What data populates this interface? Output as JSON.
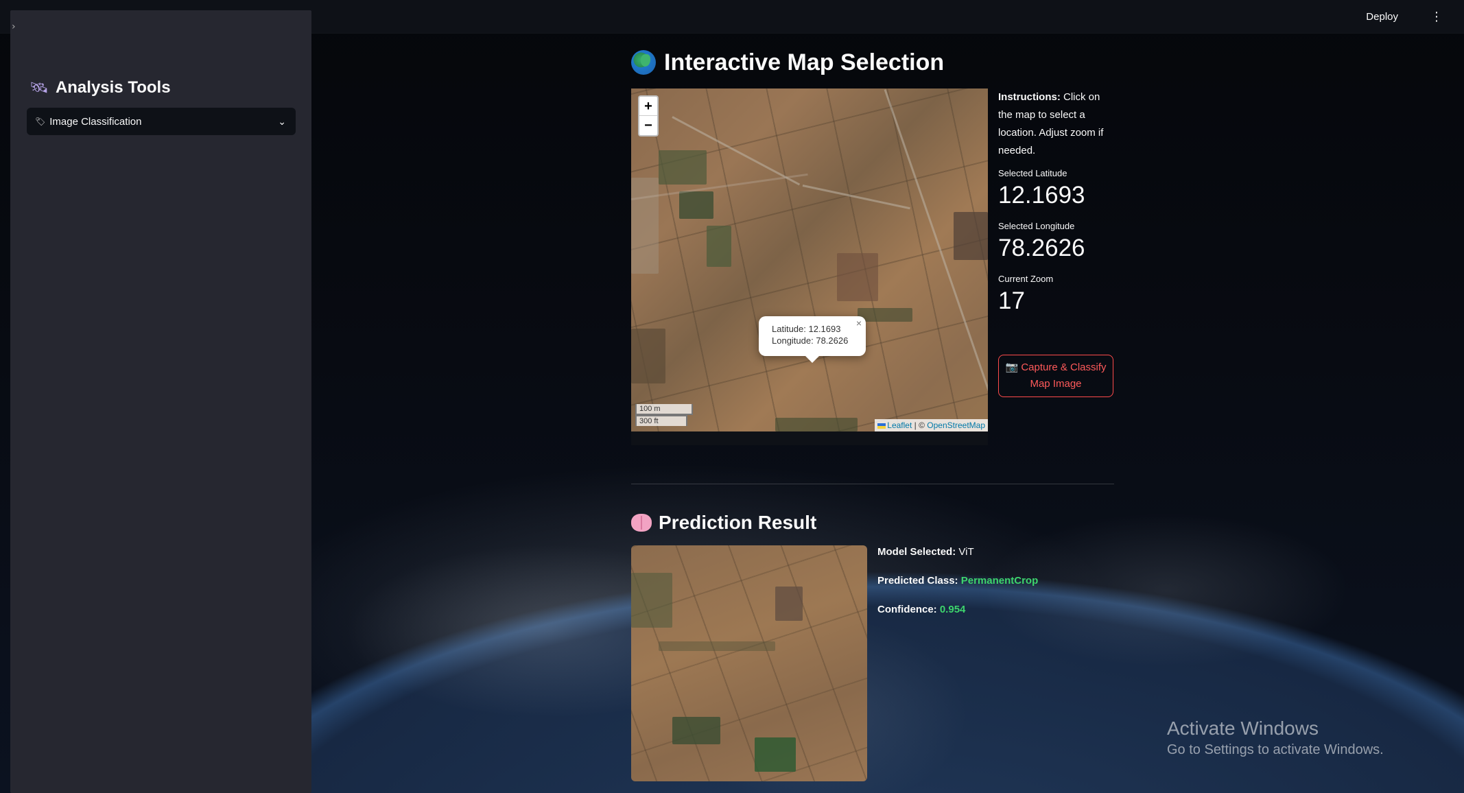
{
  "header": {
    "deploy_label": "Deploy",
    "menu_glyph": "⋮"
  },
  "sidebar": {
    "collapse_glyph": "›",
    "title_icon": "satellite-icon",
    "title": "Analysis Tools",
    "select": {
      "icon": "label-tag-icon",
      "value": "Image Classification"
    }
  },
  "map_section": {
    "title": "Interactive Map Selection",
    "icon": "globe-icon",
    "zoom_in": "+",
    "zoom_out": "−",
    "popup": {
      "latitude_line": "Latitude: 12.1693",
      "longitude_line": "Longitude: 78.2626",
      "close": "×"
    },
    "scale": {
      "metric": "100 m",
      "imperial": "300 ft"
    },
    "attribution": {
      "leaflet": "Leaflet",
      "sep": " | © ",
      "osm": "OpenStreetMap"
    }
  },
  "info": {
    "instructions_label": "Instructions:",
    "instructions_text": " Click on the map to select a location. Adjust zoom if needed.",
    "metrics": [
      {
        "label": "Selected Latitude",
        "value": "12.1693"
      },
      {
        "label": "Selected Longitude",
        "value": "78.2626"
      },
      {
        "label": "Current Zoom",
        "value": "17"
      }
    ],
    "capture_button": {
      "icon": "camera-icon",
      "label": "Capture & Classify Map Image"
    }
  },
  "prediction": {
    "title": "Prediction Result",
    "icon": "brain-icon",
    "model_label": "Model Selected:",
    "model_value": "ViT",
    "class_label": "Predicted Class:",
    "class_value": "PermanentCrop",
    "confidence_label": "Confidence:",
    "confidence_value": "0.954",
    "accent_color": "#3dd56d"
  },
  "watermark": {
    "line1": "Activate Windows",
    "line2": "Go to Settings to activate Windows."
  },
  "colors": {
    "app_bg": "#0e1117",
    "sidebar_bg": "#262730",
    "primary": "#ff4b4b"
  }
}
